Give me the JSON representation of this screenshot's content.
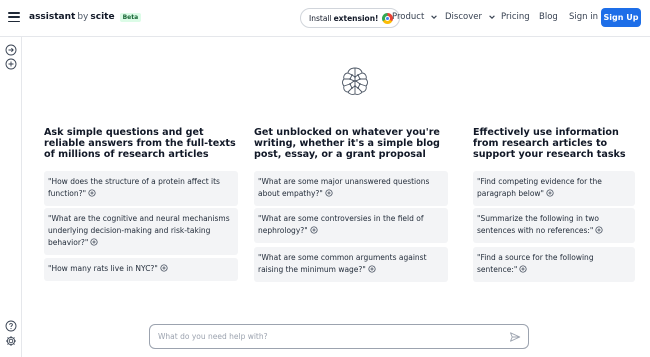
{
  "header": {
    "brand_name": "assistant",
    "brand_by": "by",
    "brand_company": "scite",
    "beta_label": "Beta",
    "install_label_prefix": "Install",
    "install_label_bold": "extension!",
    "nav": {
      "product": "Product",
      "discover": "Discover",
      "pricing": "Pricing",
      "blog": "Blog",
      "signin": "Sign in",
      "signup": "Sign Up"
    }
  },
  "columns": [
    {
      "heading": "Ask simple questions and get reliable answers from the full-texts of millions of research articles",
      "examples": [
        "\"How does the structure of a protein affect its function?\"",
        "\"What are the cognitive and neural mechanisms underlying decision-making and risk-taking behavior?\"",
        "\"How many rats live in NYC?\""
      ]
    },
    {
      "heading": "Get unblocked on whatever you're writing, whether it's a simple blog post, essay, or a grant proposal",
      "examples": [
        "\"What are some major unanswered questions about empathy?\"",
        "\"What are some controversies in the field of nephrology?\"",
        "\"What are some common arguments against raising the minimum wage?\""
      ]
    },
    {
      "heading": "Effectively use information from research articles to support your research tasks",
      "examples": [
        "\"Find competing evidence for the paragraph below\"",
        "\"Summarize the following in two sentences with no references:\"",
        "\"Find a source for the following sentence:\""
      ]
    }
  ],
  "prompt": {
    "placeholder": "What do you need help with?"
  },
  "icons": {
    "menu": "hamburger-icon",
    "browser": "chrome-icon",
    "rail_top_1": "arrow-right-circle-icon",
    "rail_top_2": "plus-circle-icon",
    "rail_bottom_1": "help-circle-icon",
    "rail_bottom_2": "gear-icon",
    "logo": "brain-icon",
    "example_action": "plus-circle-icon",
    "send": "send-icon"
  },
  "colors": {
    "accent": "#1d6ee8",
    "card_bg": "#f3f4f6",
    "beta_bg": "#dcfce7"
  }
}
